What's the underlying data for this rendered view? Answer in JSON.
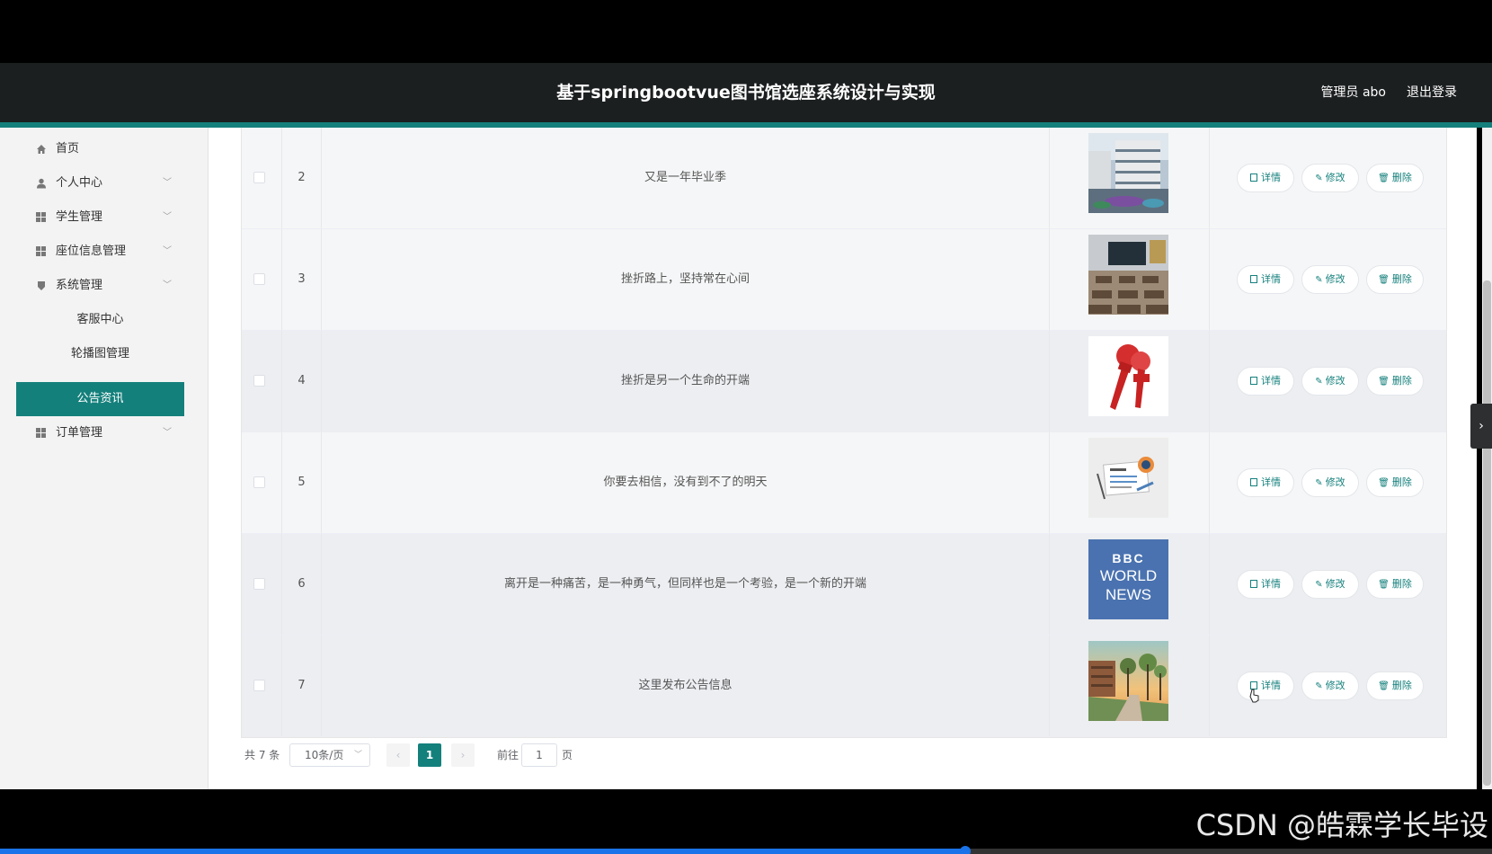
{
  "header": {
    "title": "基于springbootvue图书馆选座系统设计与实现",
    "user": "管理员 abo",
    "logout": "退出登录"
  },
  "sidebar": {
    "items": [
      {
        "label": "首页",
        "icon": "home-icon"
      },
      {
        "label": "个人中心",
        "icon": "user-icon"
      },
      {
        "label": "学生管理",
        "icon": "grid-icon"
      },
      {
        "label": "座位信息管理",
        "icon": "grid-icon"
      },
      {
        "label": "系统管理",
        "icon": "shield-icon"
      }
    ],
    "submenu": [
      {
        "label": "客服中心"
      },
      {
        "label": "轮播图管理"
      },
      {
        "label": "公告资讯"
      }
    ],
    "last_item": {
      "label": "订单管理",
      "icon": "grid-icon"
    }
  },
  "table": {
    "rows": [
      {
        "index": "2",
        "title": "又是一年毕业季",
        "image": "modern-building-image"
      },
      {
        "index": "3",
        "title": "挫折路上，坚持常在心间",
        "image": "classroom-image"
      },
      {
        "index": "4",
        "title": "挫折是另一个生命的开端",
        "image": "news-microphones-image"
      },
      {
        "index": "5",
        "title": "你要去相信，没有到不了的明天",
        "image": "newspaper-image"
      },
      {
        "index": "6",
        "title": "离开是一种痛苦，是一种勇气，但同样也是一个考验，是一个新的开端",
        "image": "bbc-world-news-image"
      },
      {
        "index": "7",
        "title": "这里发布公告信息",
        "image": "campus-sunset-image"
      }
    ],
    "actions": {
      "detail": "详情",
      "edit": "修改",
      "delete": "删除"
    },
    "bbc_logo": [
      "BBC",
      "WORLD",
      "NEWS"
    ]
  },
  "pagination": {
    "total": "共 7 条",
    "page_size": "10条/页",
    "current": "1",
    "goto_prefix": "前往",
    "goto_value": "1",
    "goto_suffix": "页"
  },
  "watermark": "CSDN @皓霖学长毕设",
  "video_progress": 0.647,
  "colors": {
    "accent": "#14807c",
    "header": "#1c1f20"
  }
}
